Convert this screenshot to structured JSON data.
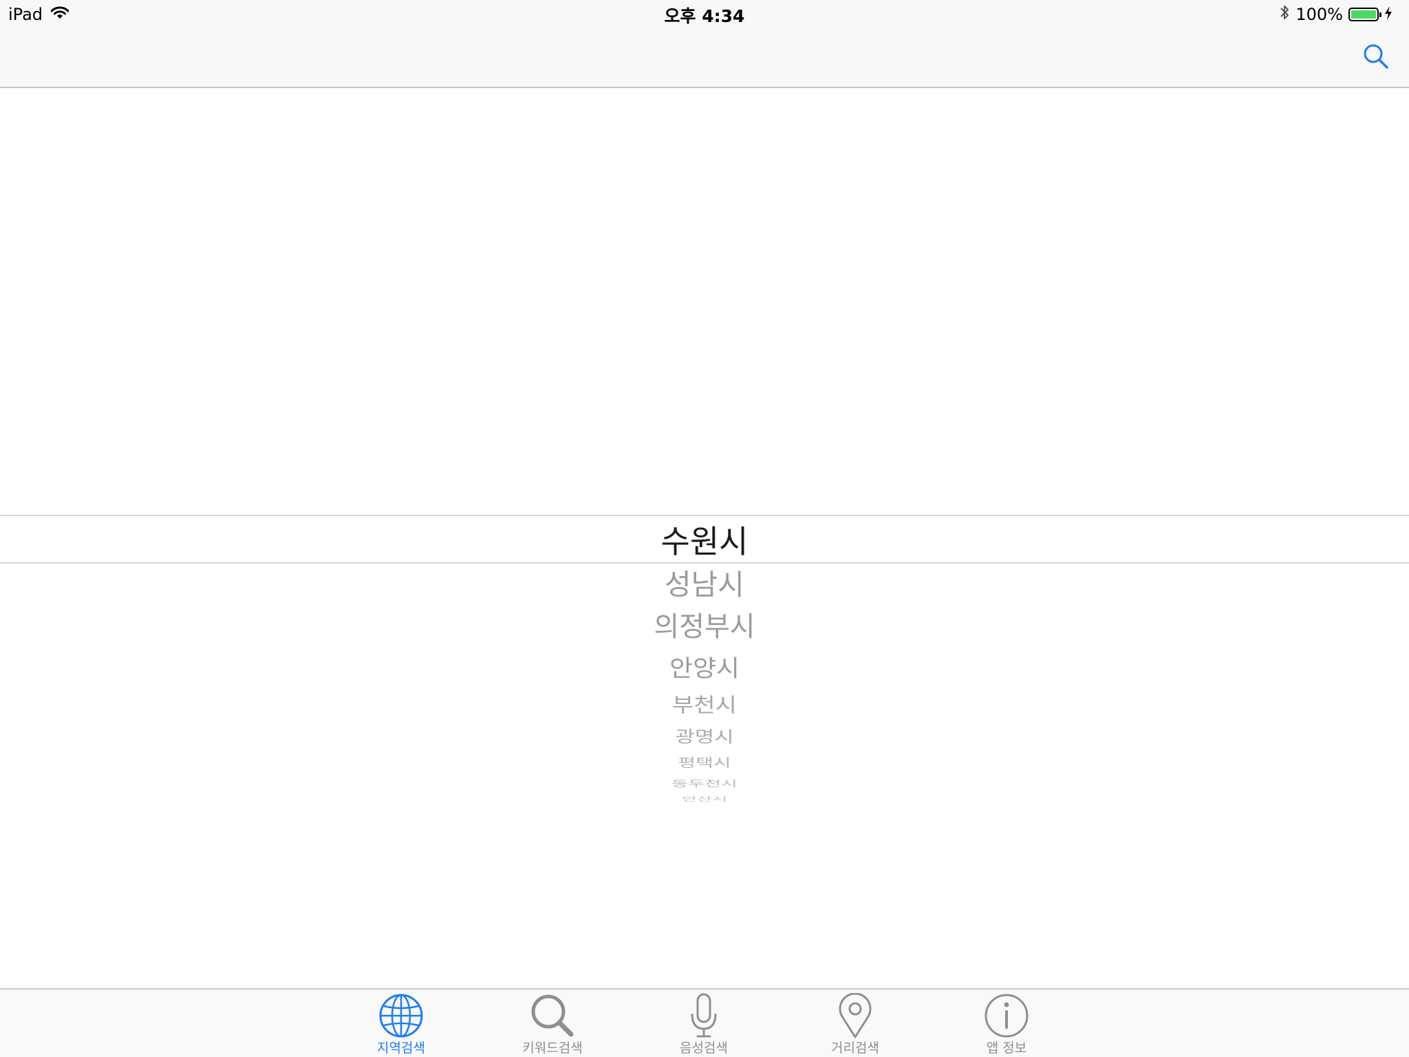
{
  "status_bar": {
    "device": "iPad",
    "time": "오후 4:34",
    "battery_percent": "100%",
    "battery_level": 1.0,
    "icons": [
      "wifi-icon",
      "bluetooth-icon",
      "battery-icon",
      "charging-bolt-icon"
    ]
  },
  "nav_bar": {
    "search_icon": "search-icon"
  },
  "picker": {
    "selected": "수원시",
    "rows_below": [
      "성남시",
      "의정부시",
      "안양시",
      "부천시",
      "광명시",
      "평택시",
      "동두천시",
      "안산시"
    ]
  },
  "tab_bar": {
    "tabs": [
      {
        "label": "지역검색",
        "icon": "globe-icon",
        "active": true
      },
      {
        "label": "키워드검색",
        "icon": "magnifier-icon",
        "active": false
      },
      {
        "label": "음성검색",
        "icon": "microphone-icon",
        "active": false
      },
      {
        "label": "거리검색",
        "icon": "location-pin-icon",
        "active": false
      },
      {
        "label": "앱 정보",
        "icon": "info-icon",
        "active": false
      }
    ]
  },
  "colors": {
    "accent": "#1e7cf2",
    "inactive": "#8e8e93",
    "battery": "#4cd964"
  }
}
